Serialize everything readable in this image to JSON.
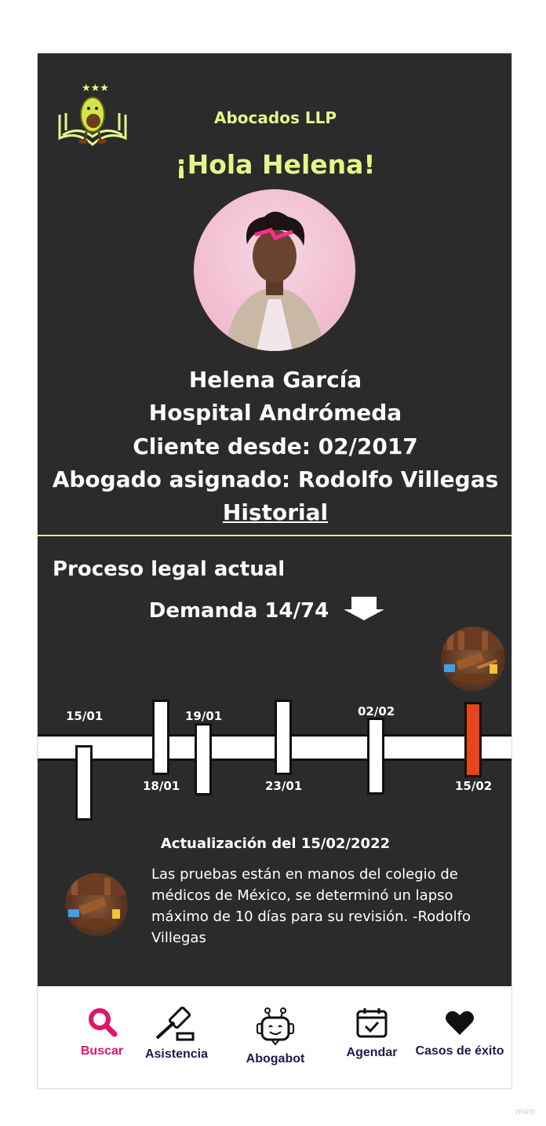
{
  "header": {
    "company": "Abocados LLP",
    "greeting": "¡Hola Helena!"
  },
  "profile": {
    "name": "Helena García",
    "organization": "Hospital Andrómeda",
    "client_since": "Cliente desde: 02/2017",
    "lawyer": "Abogado asignado: Rodolfo Villegas",
    "history_link": "Historial"
  },
  "process": {
    "title": "Proceso legal actual",
    "case": "Demanda 14/74",
    "timeline": [
      {
        "date": "15/01",
        "current": false
      },
      {
        "date": "18/01",
        "current": false
      },
      {
        "date": "19/01",
        "current": false
      },
      {
        "date": "23/01",
        "current": false
      },
      {
        "date": "02/02",
        "current": false
      },
      {
        "date": "15/02",
        "current": true
      }
    ]
  },
  "update": {
    "title": "Actualización del 15/02/2022",
    "text": "Las pruebas están en manos del colegio de médicos de México, se determinó un lapso máximo de 10 días para su revisión. -Rodolfo Villegas"
  },
  "nav": {
    "items": [
      {
        "label": "Buscar",
        "icon": "search-icon",
        "active": true
      },
      {
        "label": "Asistencia",
        "icon": "gavel-icon",
        "active": false
      },
      {
        "label": "Abogabot",
        "icon": "robot-icon",
        "active": false
      },
      {
        "label": "Agendar",
        "icon": "calendar-icon",
        "active": false
      },
      {
        "label": "Casos de éxito",
        "icon": "heart-icon",
        "active": false
      }
    ]
  },
  "colors": {
    "accent": "#e6f58a",
    "background": "#2b2b2b",
    "active_nav": "#e0156a",
    "nav_text": "#1e1a4f",
    "current_marker": "#e8441e"
  },
  "watermark": "miro"
}
